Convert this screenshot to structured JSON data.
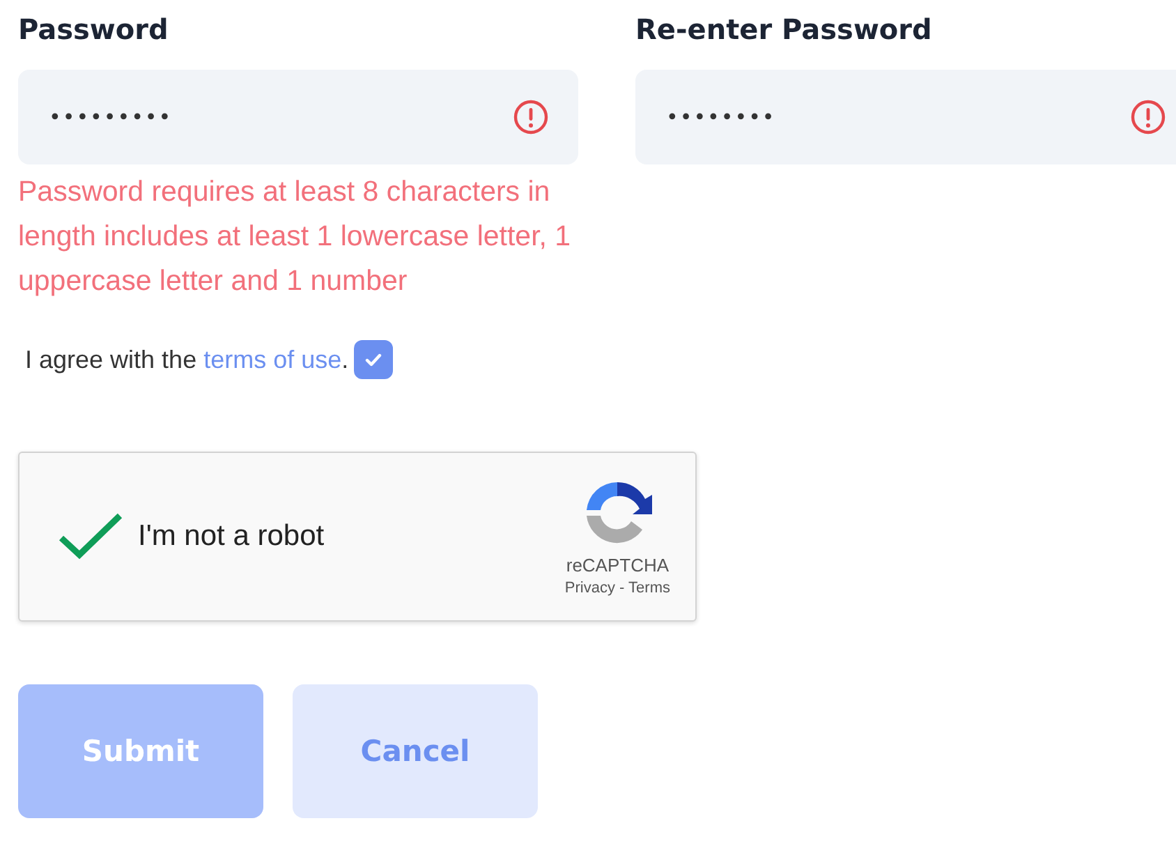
{
  "fields": [
    {
      "label": "Password",
      "value": "•••••••••",
      "error": true,
      "error_message": "Password requires at least 8 characters in length includes at least 1 lowercase letter, 1 uppercase letter and 1 number"
    },
    {
      "label": "Re-enter Password",
      "value": "••••••••",
      "error": true
    }
  ],
  "agreement": {
    "text": "I agree with the",
    "link": "terms of use",
    "suffix": ".",
    "checked": true
  },
  "captcha": {
    "checked": true,
    "label": "I'm not a robot",
    "brand": "reCAPTCHA",
    "privacy": "Privacy",
    "separator": "-",
    "terms": "Terms"
  },
  "buttons": [
    {
      "label": "Submit",
      "kind": "primary",
      "disabled": true
    },
    {
      "label": "Cancel",
      "kind": "secondary",
      "disabled": false
    }
  ]
}
